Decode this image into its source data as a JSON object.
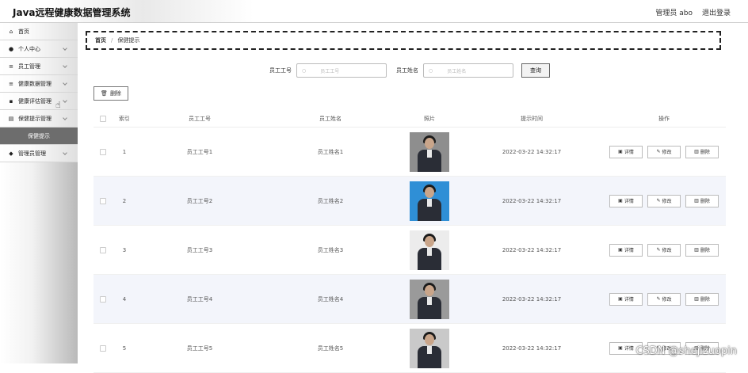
{
  "header": {
    "app_title": "Java远程健康数据管理系统",
    "user_label": "管理员 abo",
    "logout_label": "退出登录"
  },
  "sidebar": {
    "items": [
      {
        "icon": "home-icon",
        "glyph": "⌂",
        "label": "首页",
        "has_chevron": false
      },
      {
        "icon": "user-icon",
        "glyph": "●",
        "label": "个人中心",
        "has_chevron": true
      },
      {
        "icon": "list-icon",
        "glyph": "≡",
        "label": "员工管理",
        "has_chevron": true
      },
      {
        "icon": "list-icon",
        "glyph": "≡",
        "label": "健康数据管理",
        "has_chevron": true
      },
      {
        "icon": "grid-icon",
        "glyph": "▪",
        "label": "健康评估管理",
        "has_chevron": true
      },
      {
        "icon": "doc-icon",
        "glyph": "▤",
        "label": "保健提示管理",
        "has_chevron": true
      }
    ],
    "active_sub": "保健提示",
    "last_item": {
      "icon": "shield-icon",
      "glyph": "◆",
      "label": "管理员管理"
    }
  },
  "breadcrumb": {
    "home": "首页",
    "separator": "/",
    "current": "保健提示"
  },
  "search": {
    "field1_label": "员工工号",
    "field1_placeholder": "员工工号",
    "field2_label": "员工姓名",
    "field2_placeholder": "员工姓名",
    "button_label": "查询"
  },
  "toolbar": {
    "delete_label": "删除"
  },
  "table": {
    "columns": [
      "索引",
      "员工工号",
      "员工姓名",
      "照片",
      "提示时间",
      "操作"
    ],
    "row_actions": {
      "detail": "详情",
      "edit": "修改",
      "delete": "删除"
    },
    "rows": [
      {
        "index": "1",
        "emp_no": "员工工号1",
        "emp_name": "员工姓名1",
        "time": "2022-03-22 14:32:17",
        "bg": "#8e8e8e"
      },
      {
        "index": "2",
        "emp_no": "员工工号2",
        "emp_name": "员工姓名2",
        "time": "2022-03-22 14:32:17",
        "bg": "#2f8fd6"
      },
      {
        "index": "3",
        "emp_no": "员工工号3",
        "emp_name": "员工姓名3",
        "time": "2022-03-22 14:32:17",
        "bg": "#ececec"
      },
      {
        "index": "4",
        "emp_no": "员工工号4",
        "emp_name": "员工姓名4",
        "time": "2022-03-22 14:32:17",
        "bg": "#9a9a9a"
      },
      {
        "index": "5",
        "emp_no": "员工工号5",
        "emp_name": "员工姓名5",
        "time": "2022-03-22 14:32:17",
        "bg": "#c9c9c9"
      }
    ]
  },
  "watermark": "CSDN @shejizuopin"
}
